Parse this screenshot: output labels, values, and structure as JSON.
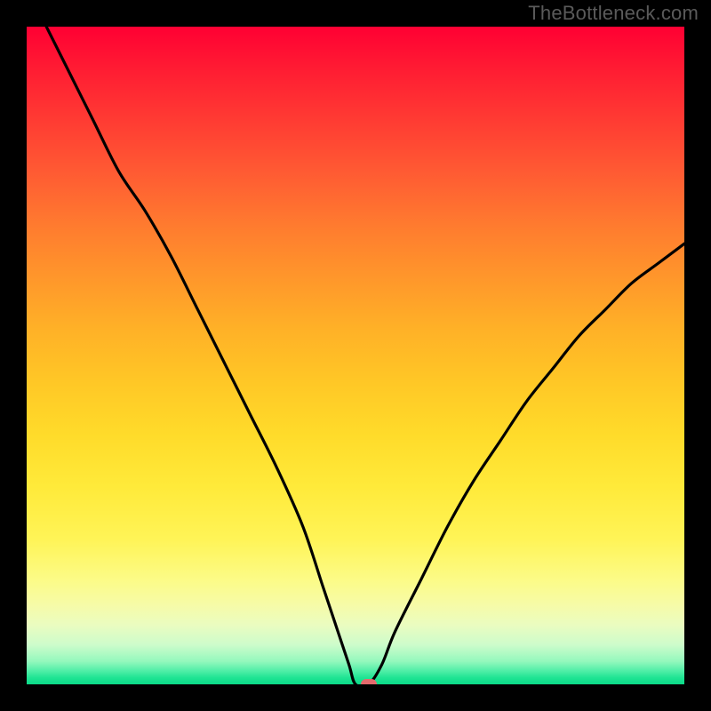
{
  "watermark": "TheBottleneck.com",
  "colors": {
    "background": "#000000",
    "curve": "#000000",
    "marker": "#e46a6d",
    "gradient_top": "#ff0033",
    "gradient_bottom": "#0bda88"
  },
  "chart_data": {
    "type": "line",
    "title": "",
    "xlabel": "",
    "ylabel": "",
    "xlim": [
      0,
      100
    ],
    "ylim": [
      0,
      100
    ],
    "x": [
      3,
      6,
      10,
      14,
      18,
      22,
      26,
      30,
      34,
      38,
      42,
      45,
      47,
      49,
      50,
      52,
      54,
      56,
      60,
      64,
      68,
      72,
      76,
      80,
      84,
      88,
      92,
      96,
      100
    ],
    "values": [
      100,
      94,
      86,
      78,
      72,
      65,
      57,
      49,
      41,
      33,
      24,
      15,
      9,
      3,
      0,
      0,
      3,
      8,
      16,
      24,
      31,
      37,
      43,
      48,
      53,
      57,
      61,
      64,
      67
    ],
    "marker": {
      "x": 52,
      "y": 0
    },
    "annotations": []
  }
}
